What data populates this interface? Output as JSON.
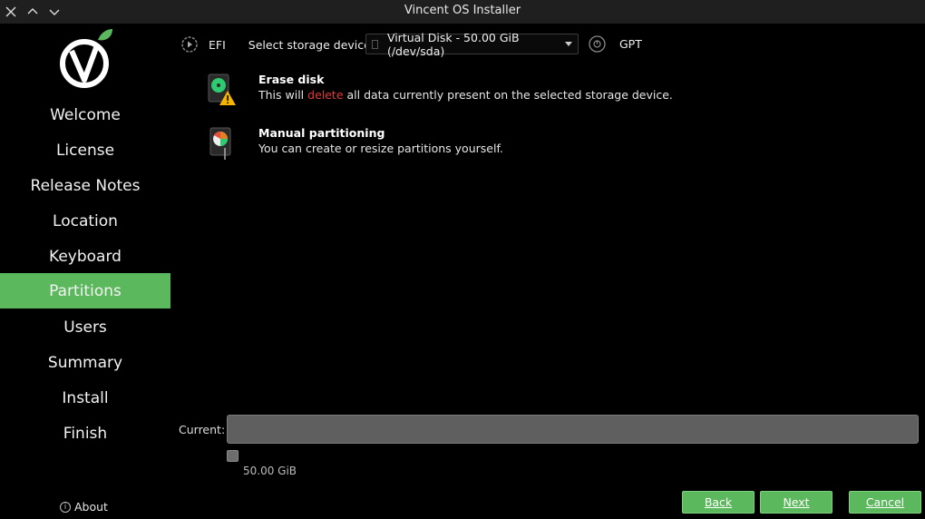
{
  "window": {
    "title": "Vincent OS Installer"
  },
  "sidebar": {
    "items": [
      {
        "label": "Welcome",
        "active": false
      },
      {
        "label": "License",
        "active": false
      },
      {
        "label": "Release Notes",
        "active": false
      },
      {
        "label": "Location",
        "active": false
      },
      {
        "label": "Keyboard",
        "active": false
      },
      {
        "label": "Partitions",
        "active": true
      },
      {
        "label": "Users",
        "active": false
      },
      {
        "label": "Summary",
        "active": false
      },
      {
        "label": "Install",
        "active": false
      },
      {
        "label": "Finish",
        "active": false
      }
    ],
    "about_label": "About"
  },
  "topbar": {
    "boot_type": "EFI",
    "select_label": "Select storage device:",
    "selected_device": "Virtual Disk - 50.00 GiB (/dev/sda)",
    "partition_table": "GPT"
  },
  "options": {
    "erase": {
      "title": "Erase disk",
      "desc_before": "This will ",
      "desc_highlight": "delete",
      "desc_after": " all data currently present on the selected storage device."
    },
    "manual": {
      "title": "Manual partitioning",
      "desc": "You can create or resize partitions yourself."
    }
  },
  "current": {
    "label": "Current:",
    "size": "50.00 GiB"
  },
  "buttons": {
    "back": "Back",
    "next": "Next",
    "cancel": "Cancel"
  },
  "colors": {
    "accent": "#5cb85c",
    "danger": "#e13a3a",
    "background": "#000000"
  }
}
